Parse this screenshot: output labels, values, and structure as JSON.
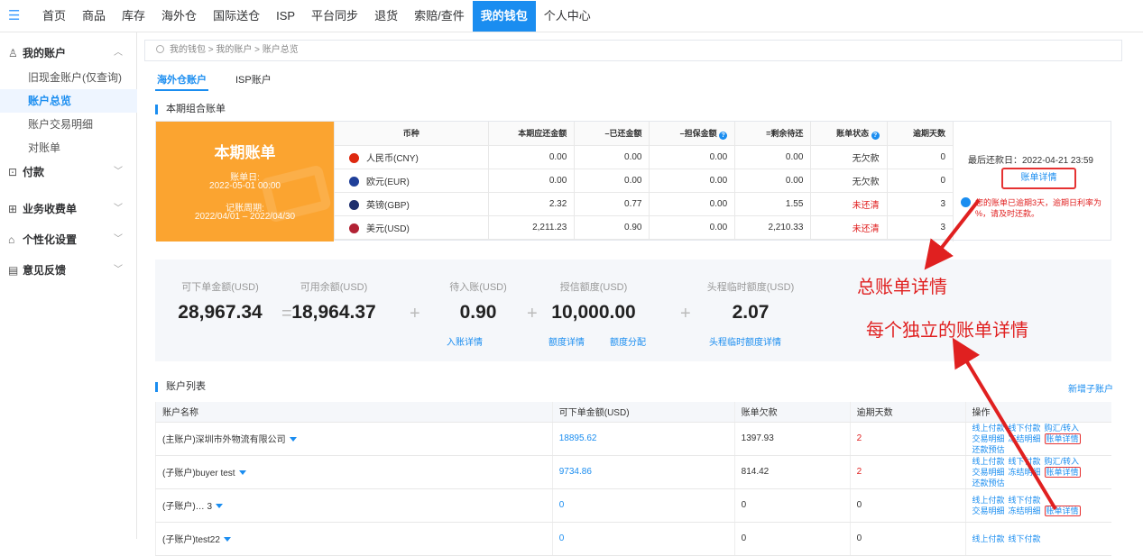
{
  "nav": {
    "items": [
      "首页",
      "商品",
      "库存",
      "海外仓",
      "国际送仓",
      "ISP",
      "平台同步",
      "退货",
      "索赔/查件",
      "我的钱包",
      "个人中心"
    ],
    "active_index": 9
  },
  "sidebar": {
    "my_account": "我的账户",
    "subs": [
      "旧现金账户(仅查询)",
      "账户总览",
      "账户交易明细",
      "对账单"
    ],
    "active_sub": 1,
    "groups": [
      "付款",
      "业务收费单",
      "个性化设置",
      "意见反馈"
    ]
  },
  "breadcrumb": "我的钱包 > 我的账户 > 账户总览",
  "tabs": [
    "海外仓账户",
    "ISP账户"
  ],
  "bill_section_title": "本期组合账单",
  "bill_card": {
    "title": "本期账单",
    "date_label": "账单日:",
    "date": "2022-05-01 00:00",
    "period_label": "记账周期:",
    "period": "2022/04/01 – 2022/04/30"
  },
  "bill_table": {
    "headers": [
      "币种",
      "本期应还金额",
      "–已还金额",
      "–担保金额",
      "=剩余待还",
      "账单状态",
      "逾期天数"
    ],
    "rows": [
      {
        "currency": "人民币(CNY)",
        "flag": "cn",
        "due": "0.00",
        "paid": "0.00",
        "guarantee": "0.00",
        "remaining": "0.00",
        "status": "无欠款",
        "overdue": "0",
        "red": false
      },
      {
        "currency": "欧元(EUR)",
        "flag": "eu",
        "due": "0.00",
        "paid": "0.00",
        "guarantee": "0.00",
        "remaining": "0.00",
        "status": "无欠款",
        "overdue": "0",
        "red": false
      },
      {
        "currency": "英镑(GBP)",
        "flag": "gb",
        "due": "2.32",
        "paid": "0.77",
        "guarantee": "0.00",
        "remaining": "1.55",
        "status": "未还清",
        "overdue": "3",
        "red": true
      },
      {
        "currency": "美元(USD)",
        "flag": "us",
        "due": "2,211.23",
        "paid": "0.90",
        "guarantee": "0.00",
        "remaining": "2,210.33",
        "status": "未还清",
        "overdue": "3",
        "red": true
      }
    ]
  },
  "bill_side": {
    "last_payment": "最后还款日：2022-04-21 23:59",
    "detail_button": "账单详情",
    "overdue_line1": "您的账单已逾期3天，逾期日利率为",
    "overdue_line2": "%，请及时还款。"
  },
  "summary": {
    "items": [
      {
        "label": "可下单金额(USD)",
        "value": "28,967.34"
      },
      {
        "label": "可用余额(USD)",
        "value": "18,964.37"
      },
      {
        "label": "待入账(USD)",
        "value": "0.90"
      },
      {
        "label": "授信额度(USD)",
        "value": "10,000.00"
      },
      {
        "label": "头程临时额度(USD)",
        "value": "2.07"
      }
    ],
    "ops": [
      "=",
      "+",
      "+",
      "+"
    ],
    "links": [
      "入账详情",
      "额度详情",
      "额度分配",
      "头程临时额度详情"
    ]
  },
  "annotations": [
    "总账单详情",
    "每个独立的账单详情"
  ],
  "account_section_title": "账户列表",
  "new_sub_account": "新增子账户",
  "account_table": {
    "headers": [
      "账户名称",
      "可下单金额(USD)",
      "账单欠款",
      "逾期天数",
      "操作"
    ],
    "rows": [
      {
        "name": "(主账户)深圳市外物流有限公司",
        "amount": "18895.62",
        "debt": "1397.93",
        "overdue": "2",
        "overdue_red": true,
        "ops1": [
          "线上付款",
          "线下付款",
          "购汇/转入"
        ],
        "ops2": [
          "交易明细",
          "冻结明细",
          "账单详情",
          "还款预估"
        ],
        "hl": "账单详情"
      },
      {
        "name": "(子账户)buyer test",
        "amount": "9734.86",
        "debt": "814.42",
        "overdue": "2",
        "overdue_red": true,
        "ops1": [
          "线上付款",
          "线下付款",
          "购汇/转入"
        ],
        "ops2": [
          "交易明细",
          "冻结明细",
          "账单详情",
          "还款预估"
        ],
        "hl": "账单详情"
      },
      {
        "name": "(子账户)… 3",
        "amount": "0",
        "debt": "0",
        "overdue": "0",
        "overdue_red": false,
        "ops1": [
          "线上付款",
          "线下付款"
        ],
        "ops2": [
          "交易明细",
          "冻结明细",
          "账单详情"
        ],
        "hl": "账单详情"
      },
      {
        "name": "(子账户)test22",
        "amount": "0",
        "debt": "0",
        "overdue": "0",
        "overdue_red": false,
        "ops1": [
          "线上付款",
          "线下付款"
        ],
        "ops2": [],
        "hl": ""
      }
    ]
  },
  "colors": {
    "accent": "#1a8df0",
    "bill_card": "#fba430",
    "danger": "#e02020"
  }
}
